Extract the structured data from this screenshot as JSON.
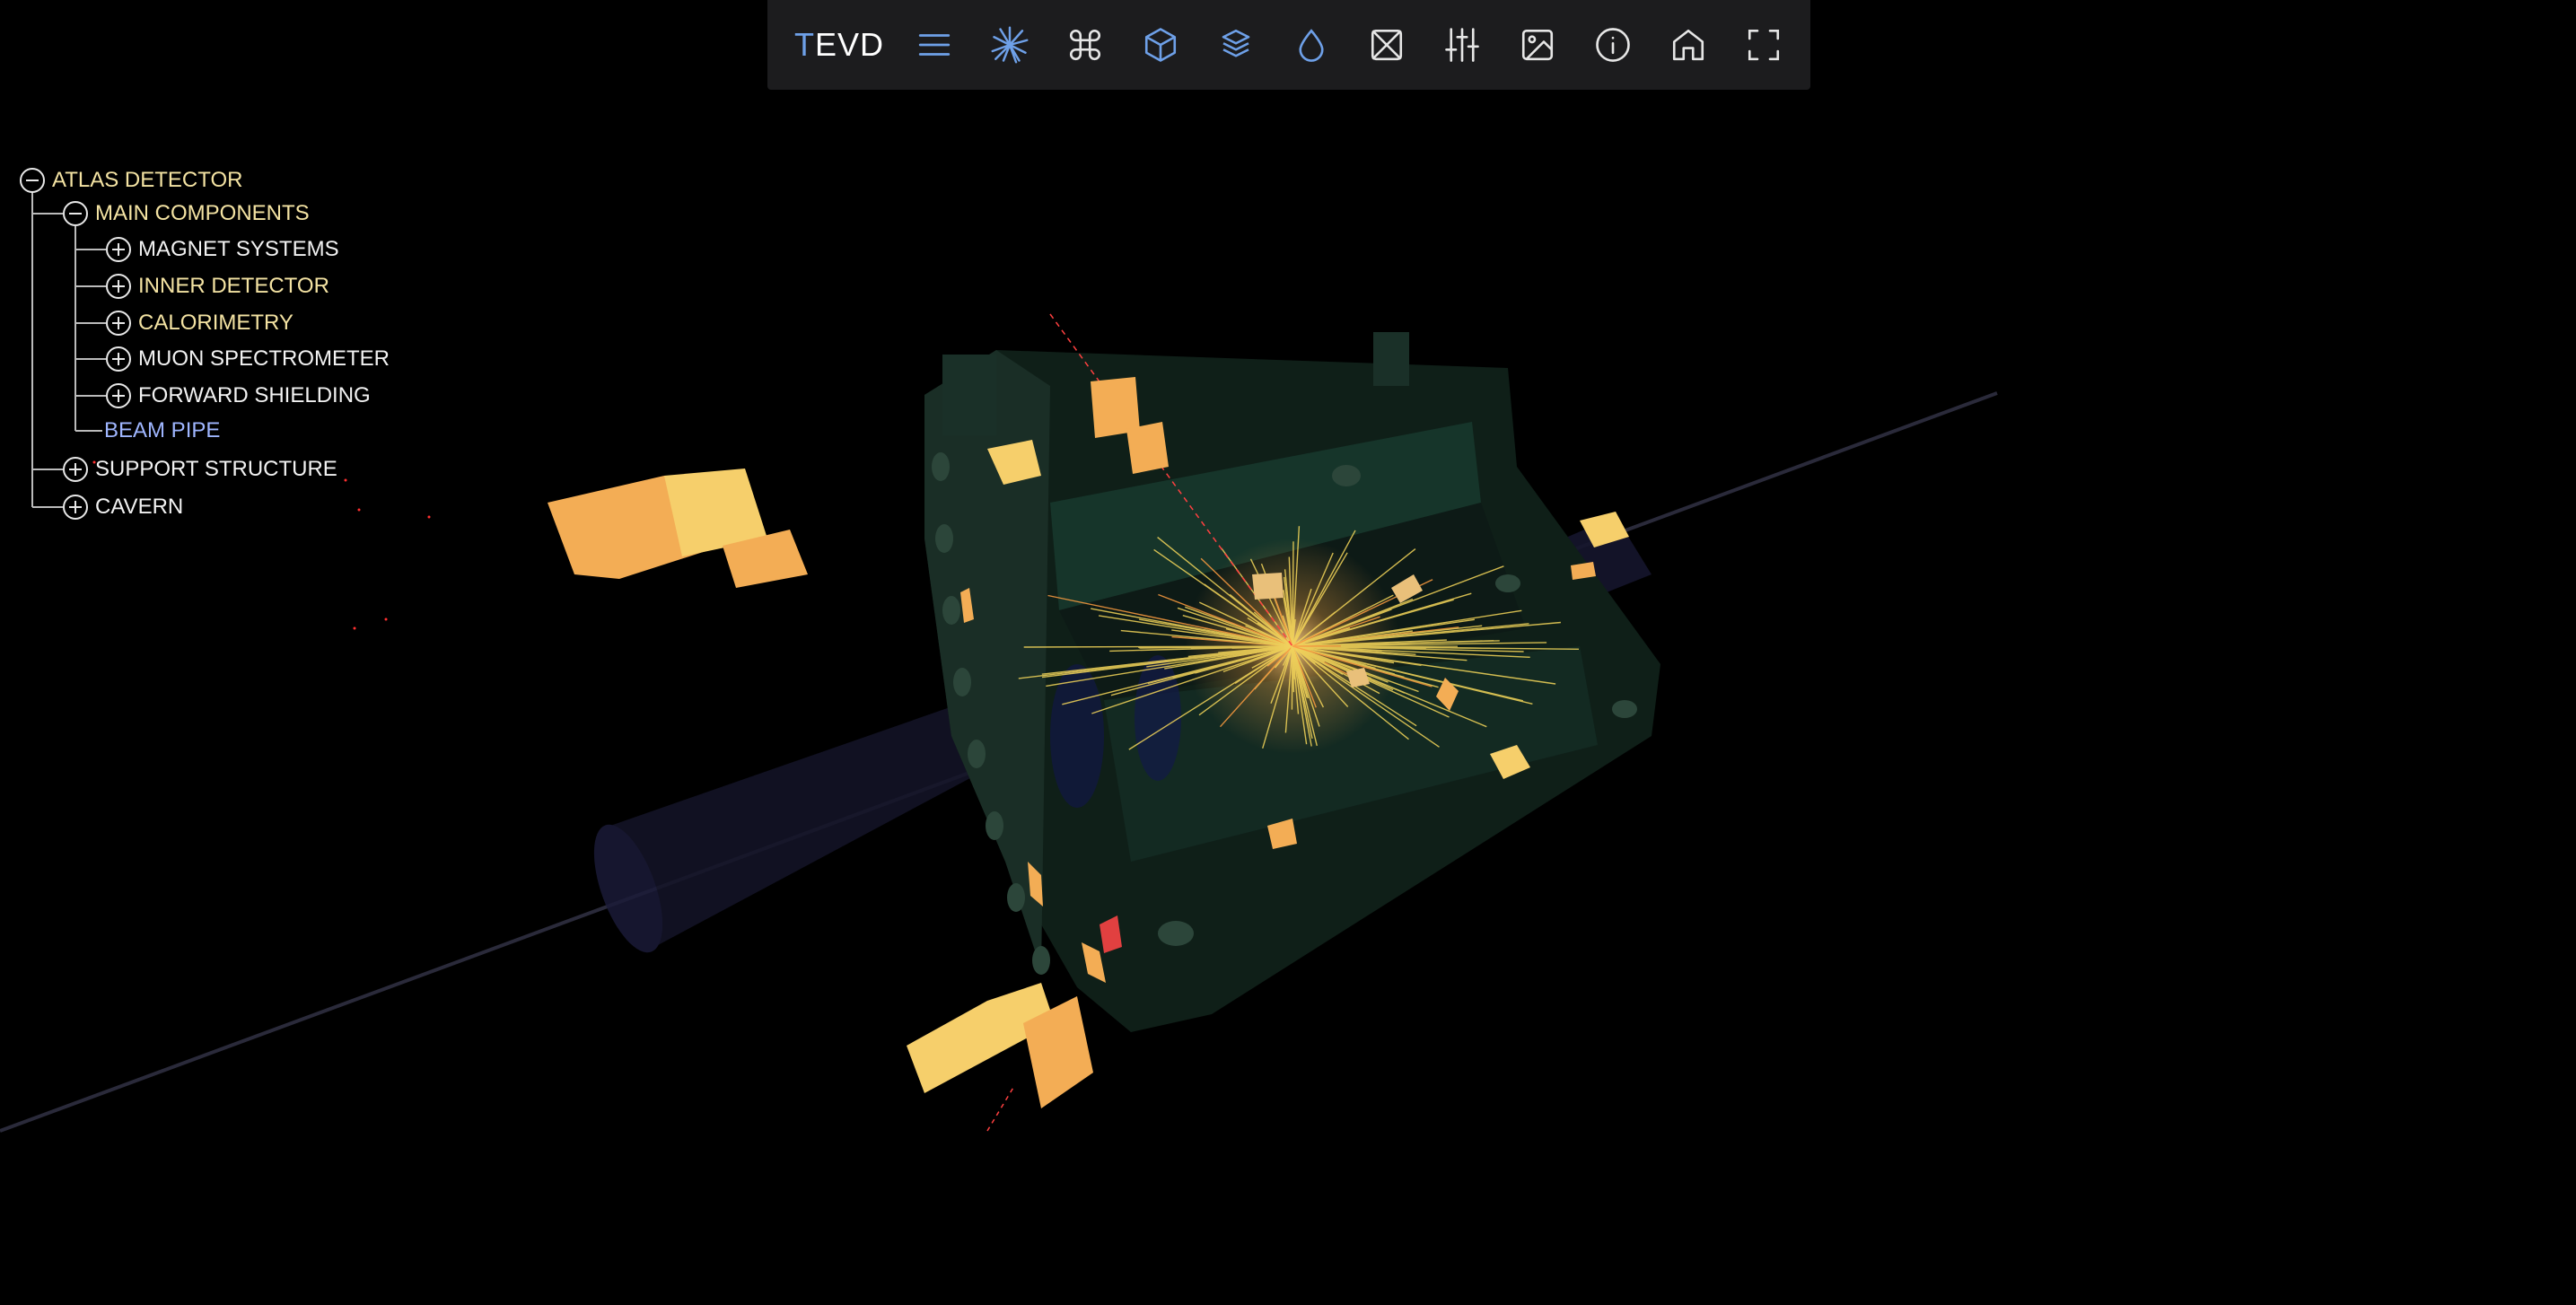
{
  "app": {
    "brand_prefix": "T",
    "brand_rest": "EVD"
  },
  "toolbar": {
    "buttons": [
      {
        "icon": "menu-icon",
        "color": "#6ea0e8"
      },
      {
        "icon": "event-burst-icon",
        "color": "#6ea0e8"
      },
      {
        "icon": "geometry-icon",
        "color": "#e6e6e6"
      },
      {
        "icon": "cube-icon",
        "color": "#6ea0e8"
      },
      {
        "icon": "layers-icon",
        "color": "#6ea0e8"
      },
      {
        "icon": "droplet-icon",
        "color": "#6ea0e8"
      },
      {
        "icon": "clear-icon",
        "color": "#e6e6e6"
      },
      {
        "icon": "settings-sliders-icon",
        "color": "#e6e6e6"
      },
      {
        "icon": "image-icon",
        "color": "#e6e6e6"
      },
      {
        "icon": "info-icon",
        "color": "#e6e6e6"
      },
      {
        "icon": "home-icon",
        "color": "#e6e6e6"
      },
      {
        "icon": "fullscreen-icon",
        "color": "#e6e6e6"
      }
    ]
  },
  "tree": {
    "root": {
      "label": "ATLAS DETECTOR",
      "expanded": true
    },
    "main_components": {
      "label": "MAIN COMPONENTS",
      "expanded": true
    },
    "children": [
      {
        "label": "MAGNET SYSTEMS",
        "expanded": false
      },
      {
        "label": "INNER DETECTOR",
        "expanded": false
      },
      {
        "label": "CALORIMETRY",
        "expanded": false
      },
      {
        "label": "MUON SPECTROMETER",
        "expanded": false
      },
      {
        "label": "FORWARD SHIELDING",
        "expanded": false
      }
    ],
    "beam_pipe": {
      "label": "BEAM PIPE"
    },
    "support_structure": {
      "label": "SUPPORT STRUCTURE",
      "expanded": false
    },
    "cavern": {
      "label": "CAVERN",
      "expanded": false
    }
  },
  "colors": {
    "accent": "#6ea0e8",
    "tree_yellow": "#f4e3a3",
    "tree_blue": "#9fb6ff",
    "track_yellow": "#f5d75a",
    "deposit_orange": "#f5b04a"
  }
}
